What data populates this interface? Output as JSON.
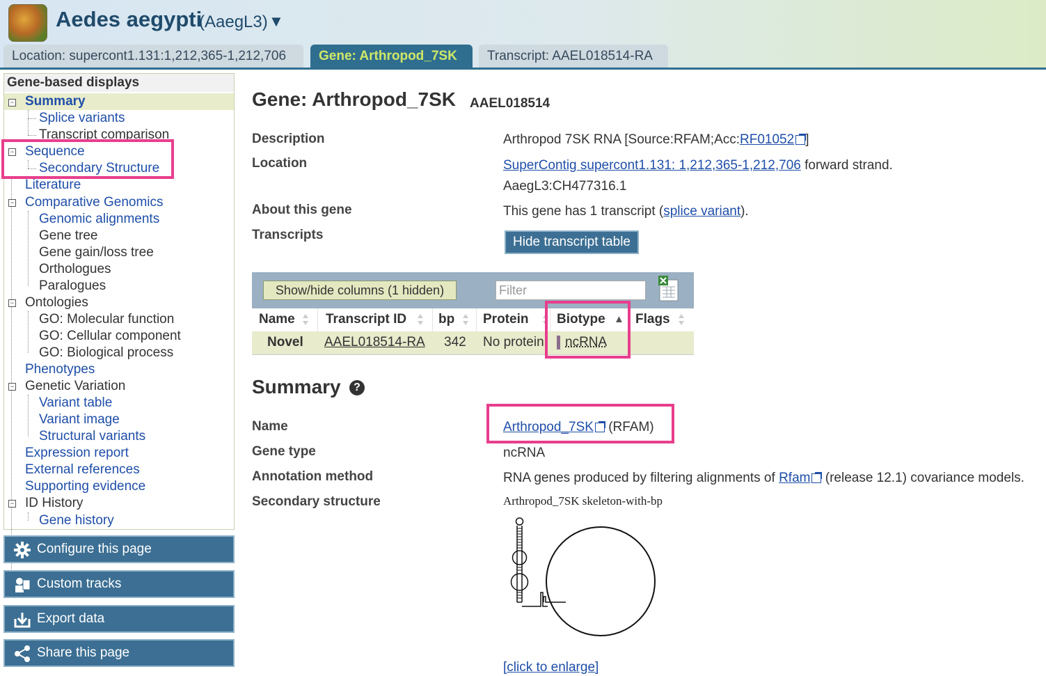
{
  "header": {
    "species": "Aedes aegypti",
    "assembly": "(AaegL3)",
    "caret": "▼"
  },
  "tabs": {
    "location": "Location: supercont1.131:1,212,365-1,212,706",
    "gene": "Gene: Arthropod_7SK",
    "transcript": "Transcript: AAEL018514-RA"
  },
  "nav": {
    "heading": "Gene-based displays",
    "items": {
      "summary": "Summary",
      "splice_variants": "Splice variants",
      "transcript_comparison": "Transcript comparison",
      "sequence": "Sequence",
      "secondary_structure": "Secondary Structure",
      "literature": "Literature",
      "comparative_genomics": "Comparative Genomics",
      "genomic_alignments": "Genomic alignments",
      "gene_tree": "Gene tree",
      "gene_gain_loss_tree": "Gene gain/loss tree",
      "orthologues": "Orthologues",
      "paralogues": "Paralogues",
      "ontologies": "Ontologies",
      "go_molecular": "GO: Molecular function",
      "go_cellular": "GO: Cellular component",
      "go_biological": "GO: Biological process",
      "phenotypes": "Phenotypes",
      "genetic_variation": "Genetic Variation",
      "variant_table": "Variant table",
      "variant_image": "Variant image",
      "structural_variants": "Structural variants",
      "expression_report": "Expression report",
      "external_references": "External references",
      "supporting_evidence": "Supporting evidence",
      "id_history": "ID History",
      "gene_history": "Gene history"
    }
  },
  "actions": {
    "configure": "Configure this page",
    "custom_tracks": "Custom tracks",
    "export": "Export data",
    "share": "Share this page"
  },
  "gene": {
    "heading": "Gene: Arthropod_7SK",
    "stable_id": "AAEL018514",
    "description_label": "Description",
    "description_text": "Arthropod 7SK RNA [Source:RFAM;Acc:",
    "description_acc": "RF01052",
    "description_end": "]",
    "location_label": "Location",
    "location_link": "SuperContig supercont1.131: 1,212,365-1,212,706",
    "location_strand": " forward strand.",
    "location_alt": "AaegL3:CH477316.1",
    "about_label": "About this gene",
    "about_text": "This gene has 1 transcript (",
    "about_link": "splice variant",
    "about_end": ").",
    "transcripts_label": "Transcripts",
    "hide_table_button": "Hide transcript table"
  },
  "transcript_table": {
    "show_hide": "Show/hide columns (1 hidden)",
    "filter_placeholder": "Filter",
    "columns": {
      "name": "Name",
      "transcript_id": "Transcript ID",
      "bp": "bp",
      "protein": "Protein",
      "biotype": "Biotype",
      "flags": "Flags"
    },
    "biotype_sort": "▲",
    "row": {
      "name": "Novel",
      "transcript_id": "AAEL018514-RA",
      "bp": "342",
      "protein": "No protein",
      "biotype": "ncRNA",
      "flags": ""
    }
  },
  "summary": {
    "heading": "Summary",
    "help": "?",
    "name_label": "Name",
    "name_link": "Arthropod_7SK",
    "name_source": " (RFAM)",
    "gene_type_label": "Gene type",
    "gene_type_value": "ncRNA",
    "annotation_label": "Annotation method",
    "annotation_text": "RNA genes produced by filtering alignments of ",
    "annotation_link": "Rfam",
    "annotation_end": " (release 12.1) covariance models.",
    "secondary_label": "Secondary structure",
    "structure_caption": "Arthropod_7SK skeleton-with-bp",
    "enlarge_link": "[click to enlarge]"
  },
  "colors": {
    "tab_active_bg": "#2f6e8f",
    "tab_active_text": "#cfe868",
    "button_bg": "#3c6f93",
    "highlight_box": "#e83e8c",
    "link": "#1f4ea8",
    "row_bg": "#e8ebcc"
  }
}
